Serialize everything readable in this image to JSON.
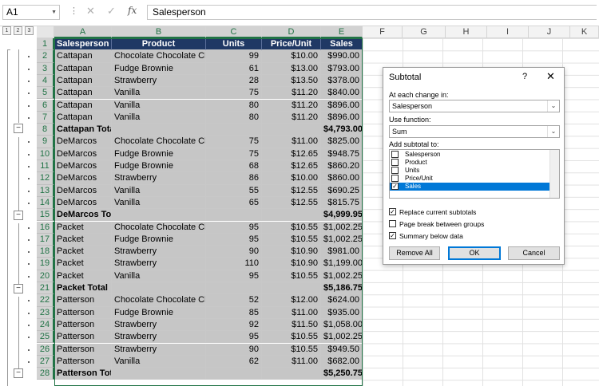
{
  "formula_bar": {
    "name_box": "A1",
    "more_label": "⋮",
    "cancel_glyph": "✕",
    "enter_glyph": "✓",
    "fx_label": "fx",
    "content": "Salesperson"
  },
  "outline_levels": [
    "1",
    "2",
    "3"
  ],
  "columns": [
    "A",
    "B",
    "C",
    "D",
    "E",
    "F",
    "G",
    "H",
    "I",
    "J",
    "K"
  ],
  "header_row": {
    "row": "1",
    "cells": [
      "Salesperson",
      "Product",
      "Units",
      "Price/Unit",
      "Sales"
    ]
  },
  "rows": [
    {
      "row": "2",
      "cells": [
        "Cattapan",
        "Chocolate Chocolate Chip",
        "99",
        "$10.00",
        "$990.00"
      ]
    },
    {
      "row": "3",
      "cells": [
        "Cattapan",
        "Fudge Brownie",
        "61",
        "$13.00",
        "$793.00"
      ]
    },
    {
      "row": "4",
      "cells": [
        "Cattapan",
        "Strawberry",
        "28",
        "$13.50",
        "$378.00"
      ]
    },
    {
      "row": "5",
      "cells": [
        "Cattapan",
        "Vanilla",
        "75",
        "$11.20",
        "$840.00"
      ]
    },
    {
      "row": "6",
      "cells": [
        "Cattapan",
        "Vanilla",
        "80",
        "$11.20",
        "$896.00"
      ]
    },
    {
      "row": "7",
      "cells": [
        "Cattapan",
        "Vanilla",
        "80",
        "$11.20",
        "$896.00"
      ]
    },
    {
      "row": "8",
      "cells": [
        "Cattapan Total",
        "",
        "",
        "",
        "$4,793.00"
      ],
      "total": true
    },
    {
      "row": "9",
      "cells": [
        "DeMarcos",
        "Chocolate Chocolate Chip",
        "75",
        "$11.00",
        "$825.00"
      ]
    },
    {
      "row": "10",
      "cells": [
        "DeMarcos",
        "Fudge Brownie",
        "75",
        "$12.65",
        "$948.75"
      ]
    },
    {
      "row": "11",
      "cells": [
        "DeMarcos",
        "Fudge Brownie",
        "68",
        "$12.65",
        "$860.20"
      ]
    },
    {
      "row": "12",
      "cells": [
        "DeMarcos",
        "Strawberry",
        "86",
        "$10.00",
        "$860.00"
      ]
    },
    {
      "row": "13",
      "cells": [
        "DeMarcos",
        "Vanilla",
        "55",
        "$12.55",
        "$690.25"
      ]
    },
    {
      "row": "14",
      "cells": [
        "DeMarcos",
        "Vanilla",
        "65",
        "$12.55",
        "$815.75"
      ]
    },
    {
      "row": "15",
      "cells": [
        "DeMarcos Total",
        "",
        "",
        "",
        "$4,999.95"
      ],
      "total": true
    },
    {
      "row": "16",
      "cells": [
        "Packet",
        "Chocolate Chocolate Chip",
        "95",
        "$10.55",
        "$1,002.25"
      ]
    },
    {
      "row": "17",
      "cells": [
        "Packet",
        "Fudge Brownie",
        "95",
        "$10.55",
        "$1,002.25"
      ]
    },
    {
      "row": "18",
      "cells": [
        "Packet",
        "Strawberry",
        "90",
        "$10.90",
        "$981.00"
      ]
    },
    {
      "row": "19",
      "cells": [
        "Packet",
        "Strawberry",
        "110",
        "$10.90",
        "$1,199.00"
      ]
    },
    {
      "row": "20",
      "cells": [
        "Packet",
        "Vanilla",
        "95",
        "$10.55",
        "$1,002.25"
      ]
    },
    {
      "row": "21",
      "cells": [
        "Packet Total",
        "",
        "",
        "",
        "$5,186.75"
      ],
      "total": true
    },
    {
      "row": "22",
      "cells": [
        "Patterson",
        "Chocolate Chocolate Chip",
        "52",
        "$12.00",
        "$624.00"
      ]
    },
    {
      "row": "23",
      "cells": [
        "Patterson",
        "Fudge Brownie",
        "85",
        "$11.00",
        "$935.00"
      ]
    },
    {
      "row": "24",
      "cells": [
        "Patterson",
        "Strawberry",
        "92",
        "$11.50",
        "$1,058.00"
      ]
    },
    {
      "row": "25",
      "cells": [
        "Patterson",
        "Strawberry",
        "95",
        "$10.55",
        "$1,002.25"
      ]
    },
    {
      "row": "26",
      "cells": [
        "Patterson",
        "Strawberry",
        "90",
        "$10.55",
        "$949.50"
      ]
    },
    {
      "row": "27",
      "cells": [
        "Patterson",
        "Vanilla",
        "62",
        "$11.00",
        "$682.00"
      ]
    },
    {
      "row": "28",
      "cells": [
        "Patterson Total",
        "",
        "",
        "",
        "$5,250.75"
      ],
      "total": true
    }
  ],
  "dialog": {
    "title": "Subtotal",
    "help": "?",
    "close": "✕",
    "at_each_change_label": "At each change in:",
    "at_each_change_value": "Salesperson",
    "use_function_label": "Use function:",
    "use_function_value": "Sum",
    "add_subtotal_label": "Add subtotal to:",
    "fields": [
      {
        "label": "Salesperson",
        "checked": false
      },
      {
        "label": "Product",
        "checked": false
      },
      {
        "label": "Units",
        "checked": false
      },
      {
        "label": "Price/Unit",
        "checked": false
      },
      {
        "label": "Sales",
        "checked": true,
        "selected": true
      }
    ],
    "options": [
      {
        "label": "Replace current subtotals",
        "checked": true
      },
      {
        "label": "Page break between groups",
        "checked": false
      },
      {
        "label": "Summary below data",
        "checked": true
      }
    ],
    "remove_all": "Remove All",
    "ok": "OK",
    "cancel": "Cancel",
    "check_glyph": "✓"
  }
}
